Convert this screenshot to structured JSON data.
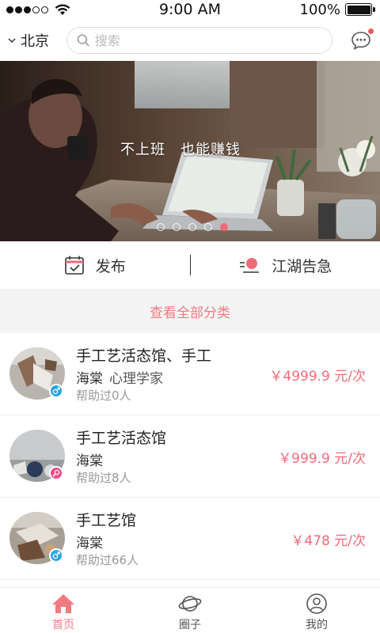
{
  "status_bar": {
    "time": "9:00 AM",
    "battery": "100%",
    "battery_level": 1.0,
    "signal_bars_filled": 3,
    "signal_bars_total": 5
  },
  "header": {
    "city": "北京",
    "search_placeholder": "搜索",
    "icons": {
      "city_toggle": "chevron-down-icon",
      "search": "search-icon",
      "messages": "chat-bubble-icon"
    },
    "message_badge_color": "#f05a5a"
  },
  "banner": {
    "caption": "不上班　也能赚钱",
    "page_count": 5,
    "active_page": 5,
    "dot_active_color": "#f06a78"
  },
  "actions": {
    "publish_label": "发布",
    "alert_label": "江湖告急",
    "icons": {
      "publish": "calendar-check-icon",
      "alert": "alarm-light-icon"
    }
  },
  "categories": {
    "label": "查看全部分类",
    "color": "#f07a7f"
  },
  "services": [
    {
      "title": "手工艺活态馆、手工",
      "name": "海棠",
      "role": "心理学家",
      "helped": "帮助过0人",
      "price": "￥4999.9 元/次",
      "gender": "male"
    },
    {
      "title": "手工艺活态馆",
      "name": "海棠",
      "role": "",
      "helped": "帮助过8人",
      "price": "￥999.9 元/次",
      "gender": "female"
    },
    {
      "title": "手工艺馆",
      "name": "海棠",
      "role": "",
      "helped": "帮助过66人",
      "price": "￥478 元/次",
      "gender": "male"
    }
  ],
  "tabbar": {
    "items": [
      {
        "label": "首页",
        "icon": "home-icon",
        "active": true
      },
      {
        "label": "圈子",
        "icon": "planet-icon",
        "active": false
      },
      {
        "label": "我的",
        "icon": "user-icon",
        "active": false
      }
    ],
    "active_color": "#f07a7f"
  }
}
